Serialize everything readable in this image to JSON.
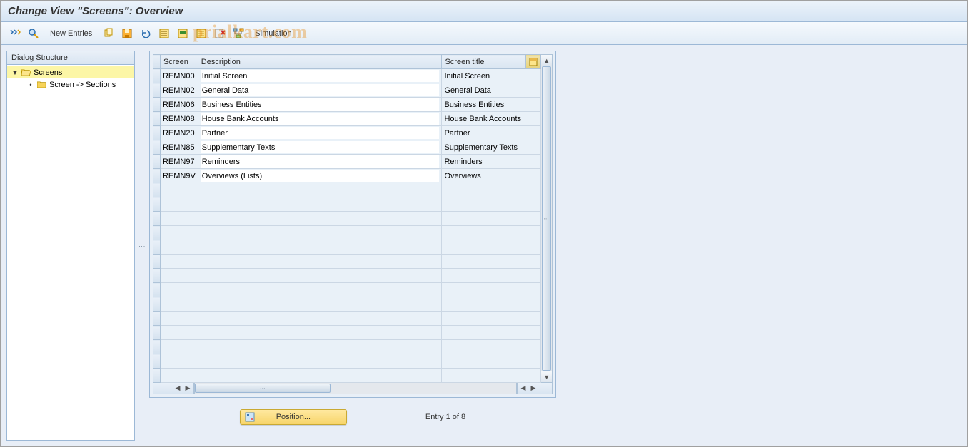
{
  "title": "Change View \"Screens\": Overview",
  "watermark": "prialkart.com",
  "toolbar": {
    "new_entries": "New Entries",
    "simulation": "Simulation"
  },
  "dialog": {
    "header": "Dialog Structure",
    "items": [
      {
        "label": "Screens",
        "selected": true,
        "open": true
      },
      {
        "label": "Screen -> Sections",
        "selected": false,
        "open": false
      }
    ]
  },
  "table": {
    "headers": {
      "screen": "Screen",
      "description": "Description",
      "screen_title": "Screen title"
    },
    "rows": [
      {
        "screen": "REMN00",
        "description": "Initial Screen",
        "title": "Initial Screen"
      },
      {
        "screen": "REMN02",
        "description": "General Data",
        "title": "General Data"
      },
      {
        "screen": "REMN06",
        "description": "Business Entities",
        "title": "Business Entities"
      },
      {
        "screen": "REMN08",
        "description": "House Bank Accounts",
        "title": "House Bank Accounts"
      },
      {
        "screen": "REMN20",
        "description": "Partner",
        "title": "Partner"
      },
      {
        "screen": "REMN85",
        "description": "Supplementary Texts",
        "title": "Supplementary Texts"
      },
      {
        "screen": "REMN97",
        "description": "Reminders",
        "title": "Reminders"
      },
      {
        "screen": "REMN9V",
        "description": "Overviews (Lists)",
        "title": "Overviews"
      }
    ],
    "empty_rows": 14
  },
  "footer": {
    "position_label": "Position...",
    "entry_text": "Entry 1 of 8"
  }
}
